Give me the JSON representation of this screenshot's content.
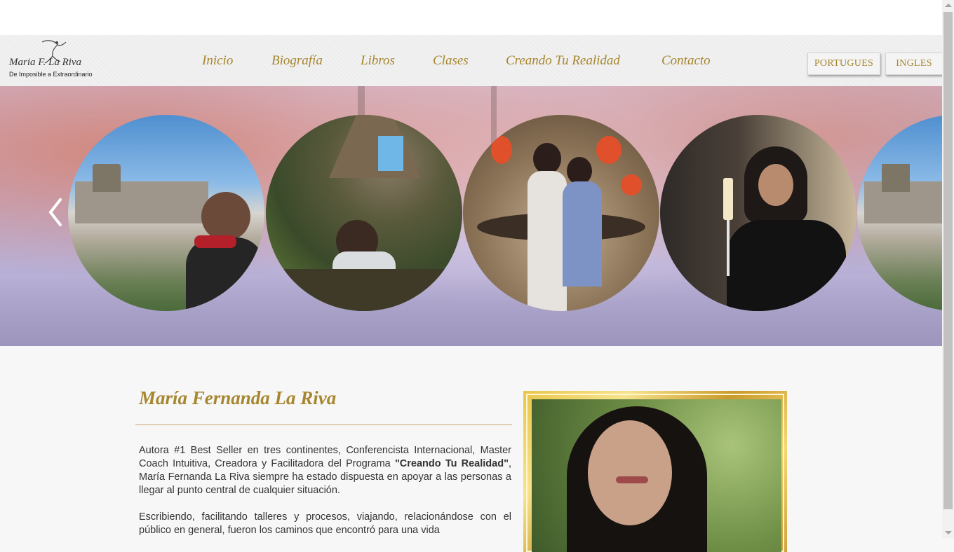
{
  "logo": {
    "script_text": "Maria F. La Riva",
    "tagline": "De Imposible a Extraordinario"
  },
  "nav": {
    "items": [
      {
        "label": "Inicio"
      },
      {
        "label": "Biografía"
      },
      {
        "label": "Libros"
      },
      {
        "label": "Clases"
      },
      {
        "label": "Creando Tu Realidad"
      },
      {
        "label": "Contacto"
      }
    ]
  },
  "language": {
    "portuguese": "PORTUGUES",
    "english": "INGLES"
  },
  "slider": {
    "prev_icon": "chevron-left-icon"
  },
  "profile": {
    "name": "María Fernanda La Riva"
  },
  "bio": {
    "p1_a": "Autora #1 Best Seller en tres continentes, Conferencista Internacional, Master Coach Intuitiva, Creadora y Facilitadora del Programa ",
    "p1_bold": "\"Creando Tu Realidad\"",
    "p1_b": ", María Fernanda La Riva siempre ha estado dispuesta en apoyar a las personas a llegar al punto central de cualquier situación.",
    "p2": "Escribiendo, facilitando talleres y procesos, viajando, relacionándose con el público en general,  fueron los caminos que encontró para una vida"
  },
  "colors": {
    "accent_gold": "#a6862e",
    "divider": "#c7a46a"
  }
}
